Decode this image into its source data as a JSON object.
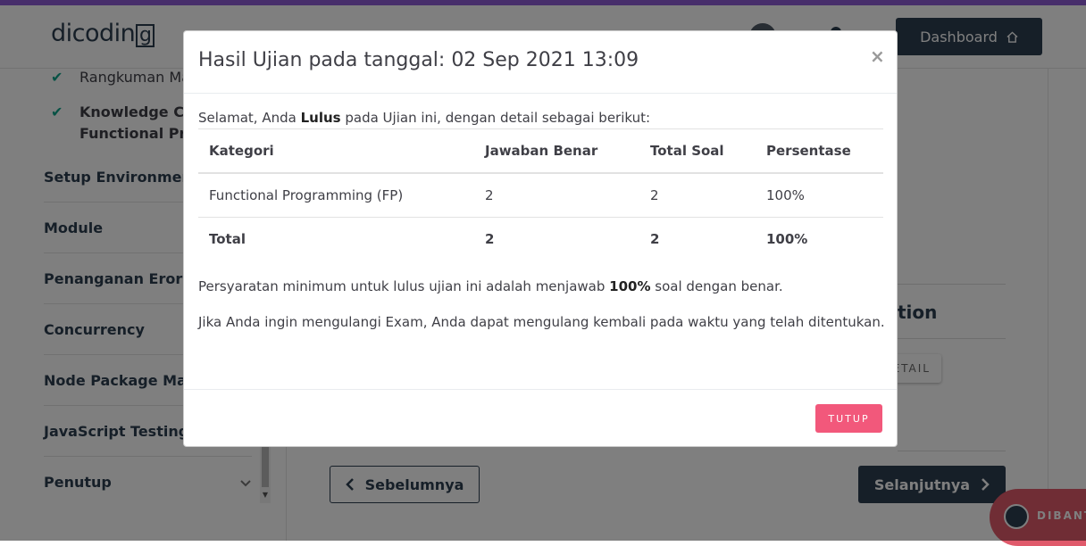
{
  "header": {
    "logo_text": "dicodin",
    "logo_box_letter": "g",
    "dashboard_label": "Dashboard"
  },
  "sidebar": {
    "sub_items": [
      {
        "label": "Rangkuman Ma"
      },
      {
        "label_line1": "Knowledge Che",
        "label_line2": "Functional Pro"
      }
    ],
    "sections": [
      {
        "label": "Setup Environment"
      },
      {
        "label": "Module"
      },
      {
        "label": "Penanganan Eror"
      },
      {
        "label": "Concurrency"
      },
      {
        "label": "Node Package Mana"
      },
      {
        "label": "JavaScript Testing"
      },
      {
        "label": "Penutup"
      }
    ]
  },
  "behind": {
    "section_title_fragment": "tion",
    "detail_button_fragment": "ETAIL",
    "prev_label": "Sebelumnya",
    "next_label": "Selanjutnya",
    "help_label": "DIBANT"
  },
  "modal": {
    "title": "Hasil Ujian pada tanggal: 02 Sep 2021 13:09",
    "close_symbol": "×",
    "intro_prefix": "Selamat, Anda ",
    "intro_status": "Lulus",
    "intro_suffix": " pada Ujian ini, dengan detail sebagai berikut:",
    "table": {
      "headers": [
        "Kategori",
        "Jawaban Benar",
        "Total Soal",
        "Persentase"
      ],
      "rows": [
        [
          "Functional Programming (FP)",
          "2",
          "2",
          "100%"
        ]
      ],
      "total": [
        "Total",
        "2",
        "2",
        "100%"
      ]
    },
    "requirement_prefix": "Persyaratan minimum untuk lulus ujian ini adalah menjawab ",
    "requirement_value": "100%",
    "requirement_suffix": " soal dengan benar.",
    "retake_note": "Jika Anda ingin mengulangi Exam, Anda dapat mengulang kembali pada waktu yang telah ditentukan.",
    "close_button_label": "TUTUP"
  },
  "colors": {
    "accent_bar": "#8f5cd6",
    "primary_dark": "#2d3e50",
    "check_green": "#0fa58a",
    "close_button": "#f2587b",
    "help_fab": "#e05a6b"
  }
}
